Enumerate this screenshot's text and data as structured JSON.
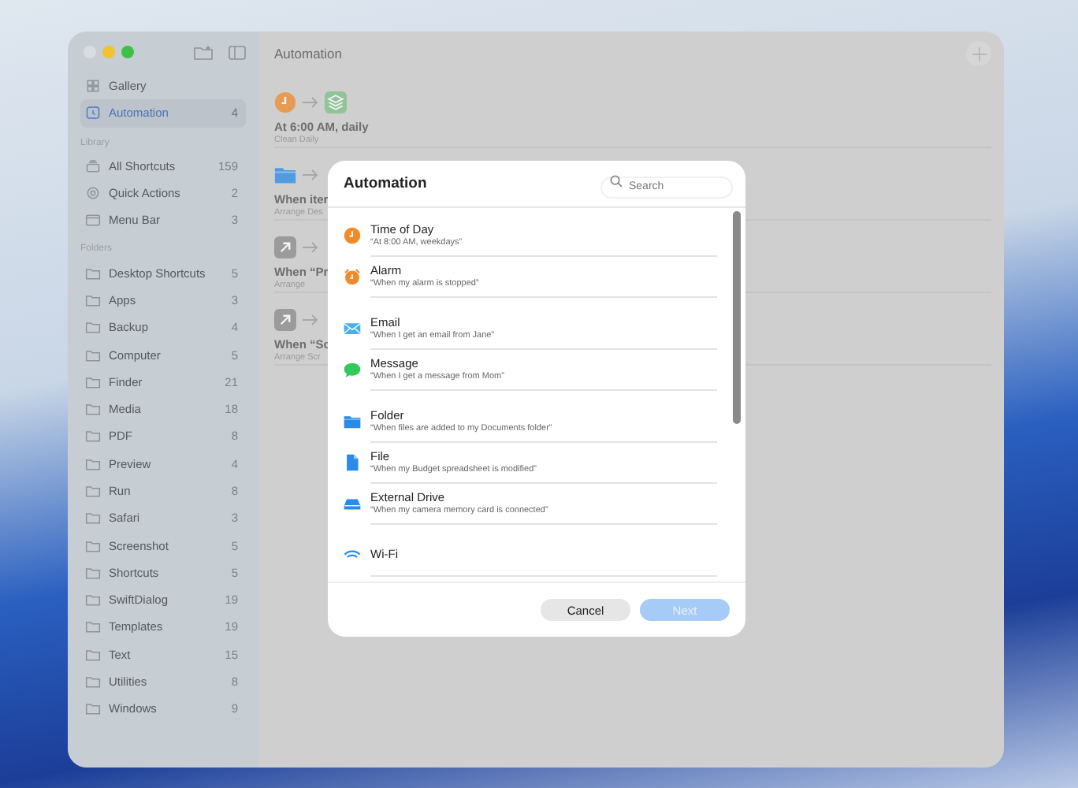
{
  "window": {
    "title": "Automation"
  },
  "sidebar": {
    "items": [
      {
        "label": "Gallery",
        "kind": "gallery",
        "selected": false
      },
      {
        "label": "Automation",
        "kind": "automation",
        "count": "4",
        "selected": true
      }
    ],
    "sections": [
      {
        "title": "Library",
        "items": [
          {
            "label": "All Shortcuts",
            "kind": "stack",
            "count": "159",
            "selected": false
          },
          {
            "label": "Quick Actions",
            "kind": "gear",
            "count": "2",
            "selected": false
          },
          {
            "label": "Menu Bar",
            "kind": "menubar",
            "count": "3",
            "selected": false
          }
        ]
      },
      {
        "title": "Folders",
        "items": [
          {
            "label": "Desktop Shortcuts",
            "kind": "folder",
            "count": "5",
            "selected": false
          },
          {
            "label": "Apps",
            "kind": "folder",
            "count": "3",
            "selected": false
          },
          {
            "label": "Backup",
            "kind": "folder",
            "count": "4",
            "selected": false
          },
          {
            "label": "Computer",
            "kind": "folder",
            "count": "5",
            "selected": false
          },
          {
            "label": "Finder",
            "kind": "folder",
            "count": "21",
            "selected": false
          },
          {
            "label": "Media",
            "kind": "folder",
            "count": "18",
            "selected": false
          },
          {
            "label": "PDF",
            "kind": "folder",
            "count": "8",
            "selected": false
          },
          {
            "label": "Preview",
            "kind": "folder",
            "count": "4",
            "selected": false
          },
          {
            "label": "Run",
            "kind": "folder",
            "count": "8",
            "selected": false
          },
          {
            "label": "Safari",
            "kind": "folder",
            "count": "3",
            "selected": false
          },
          {
            "label": "Screenshot",
            "kind": "folder",
            "count": "5",
            "selected": false
          },
          {
            "label": "Shortcuts",
            "kind": "folder",
            "count": "5",
            "selected": false
          },
          {
            "label": "SwiftDialog",
            "kind": "folder",
            "count": "19",
            "selected": false
          },
          {
            "label": "Templates",
            "kind": "folder",
            "count": "19",
            "selected": false
          },
          {
            "label": "Text",
            "kind": "folder",
            "count": "15",
            "selected": false
          },
          {
            "label": "Utilities",
            "kind": "folder",
            "count": "8",
            "selected": false
          },
          {
            "label": "Windows",
            "kind": "folder",
            "count": "9",
            "selected": false
          }
        ]
      }
    ]
  },
  "automations": [
    {
      "icons": [
        {
          "kind": "clock"
        },
        {
          "kind": "layers"
        }
      ],
      "title": "At 6:00 AM, daily",
      "subtitle": "Clean Daily"
    },
    {
      "icons": [
        {
          "kind": "folder"
        }
      ],
      "title": "When iter",
      "subtitle": "Arrange Des"
    },
    {
      "icons": [
        {
          "kind": "shortcut"
        }
      ],
      "title": "When “Pr",
      "subtitle": "Arrange"
    },
    {
      "icons": [
        {
          "kind": "shortcut"
        }
      ],
      "title": "When “Sc",
      "subtitle": "Arrange Scr"
    }
  ],
  "dialog": {
    "title": "Automation",
    "search": {
      "placeholder": "Search"
    },
    "groups": [
      [
        {
          "kind": "clock",
          "title": "Time of Day",
          "subtitle": "“At 8:00 AM, weekdays”"
        },
        {
          "kind": "alarm",
          "title": "Alarm",
          "subtitle": "“When my alarm is stopped”"
        }
      ],
      [
        {
          "kind": "mail",
          "title": "Email",
          "subtitle": "“When I get an email from Jane”"
        },
        {
          "kind": "message",
          "title": "Message",
          "subtitle": "“When I get a message from Mom”"
        }
      ],
      [
        {
          "kind": "folder",
          "title": "Folder",
          "subtitle": "“When files are added to my Documents folder”"
        },
        {
          "kind": "file",
          "title": "File",
          "subtitle": "“When my Budget spreadsheet is modified”"
        },
        {
          "kind": "drive",
          "title": "External Drive",
          "subtitle": "“When my camera memory card is connected”"
        }
      ],
      [
        {
          "kind": "wifi",
          "title": "Wi-Fi"
        }
      ]
    ],
    "buttons": [
      {
        "label": "Cancel",
        "kind": "secondary",
        "disabled": false
      },
      {
        "label": "Next",
        "kind": "primary",
        "disabled": true
      }
    ]
  }
}
